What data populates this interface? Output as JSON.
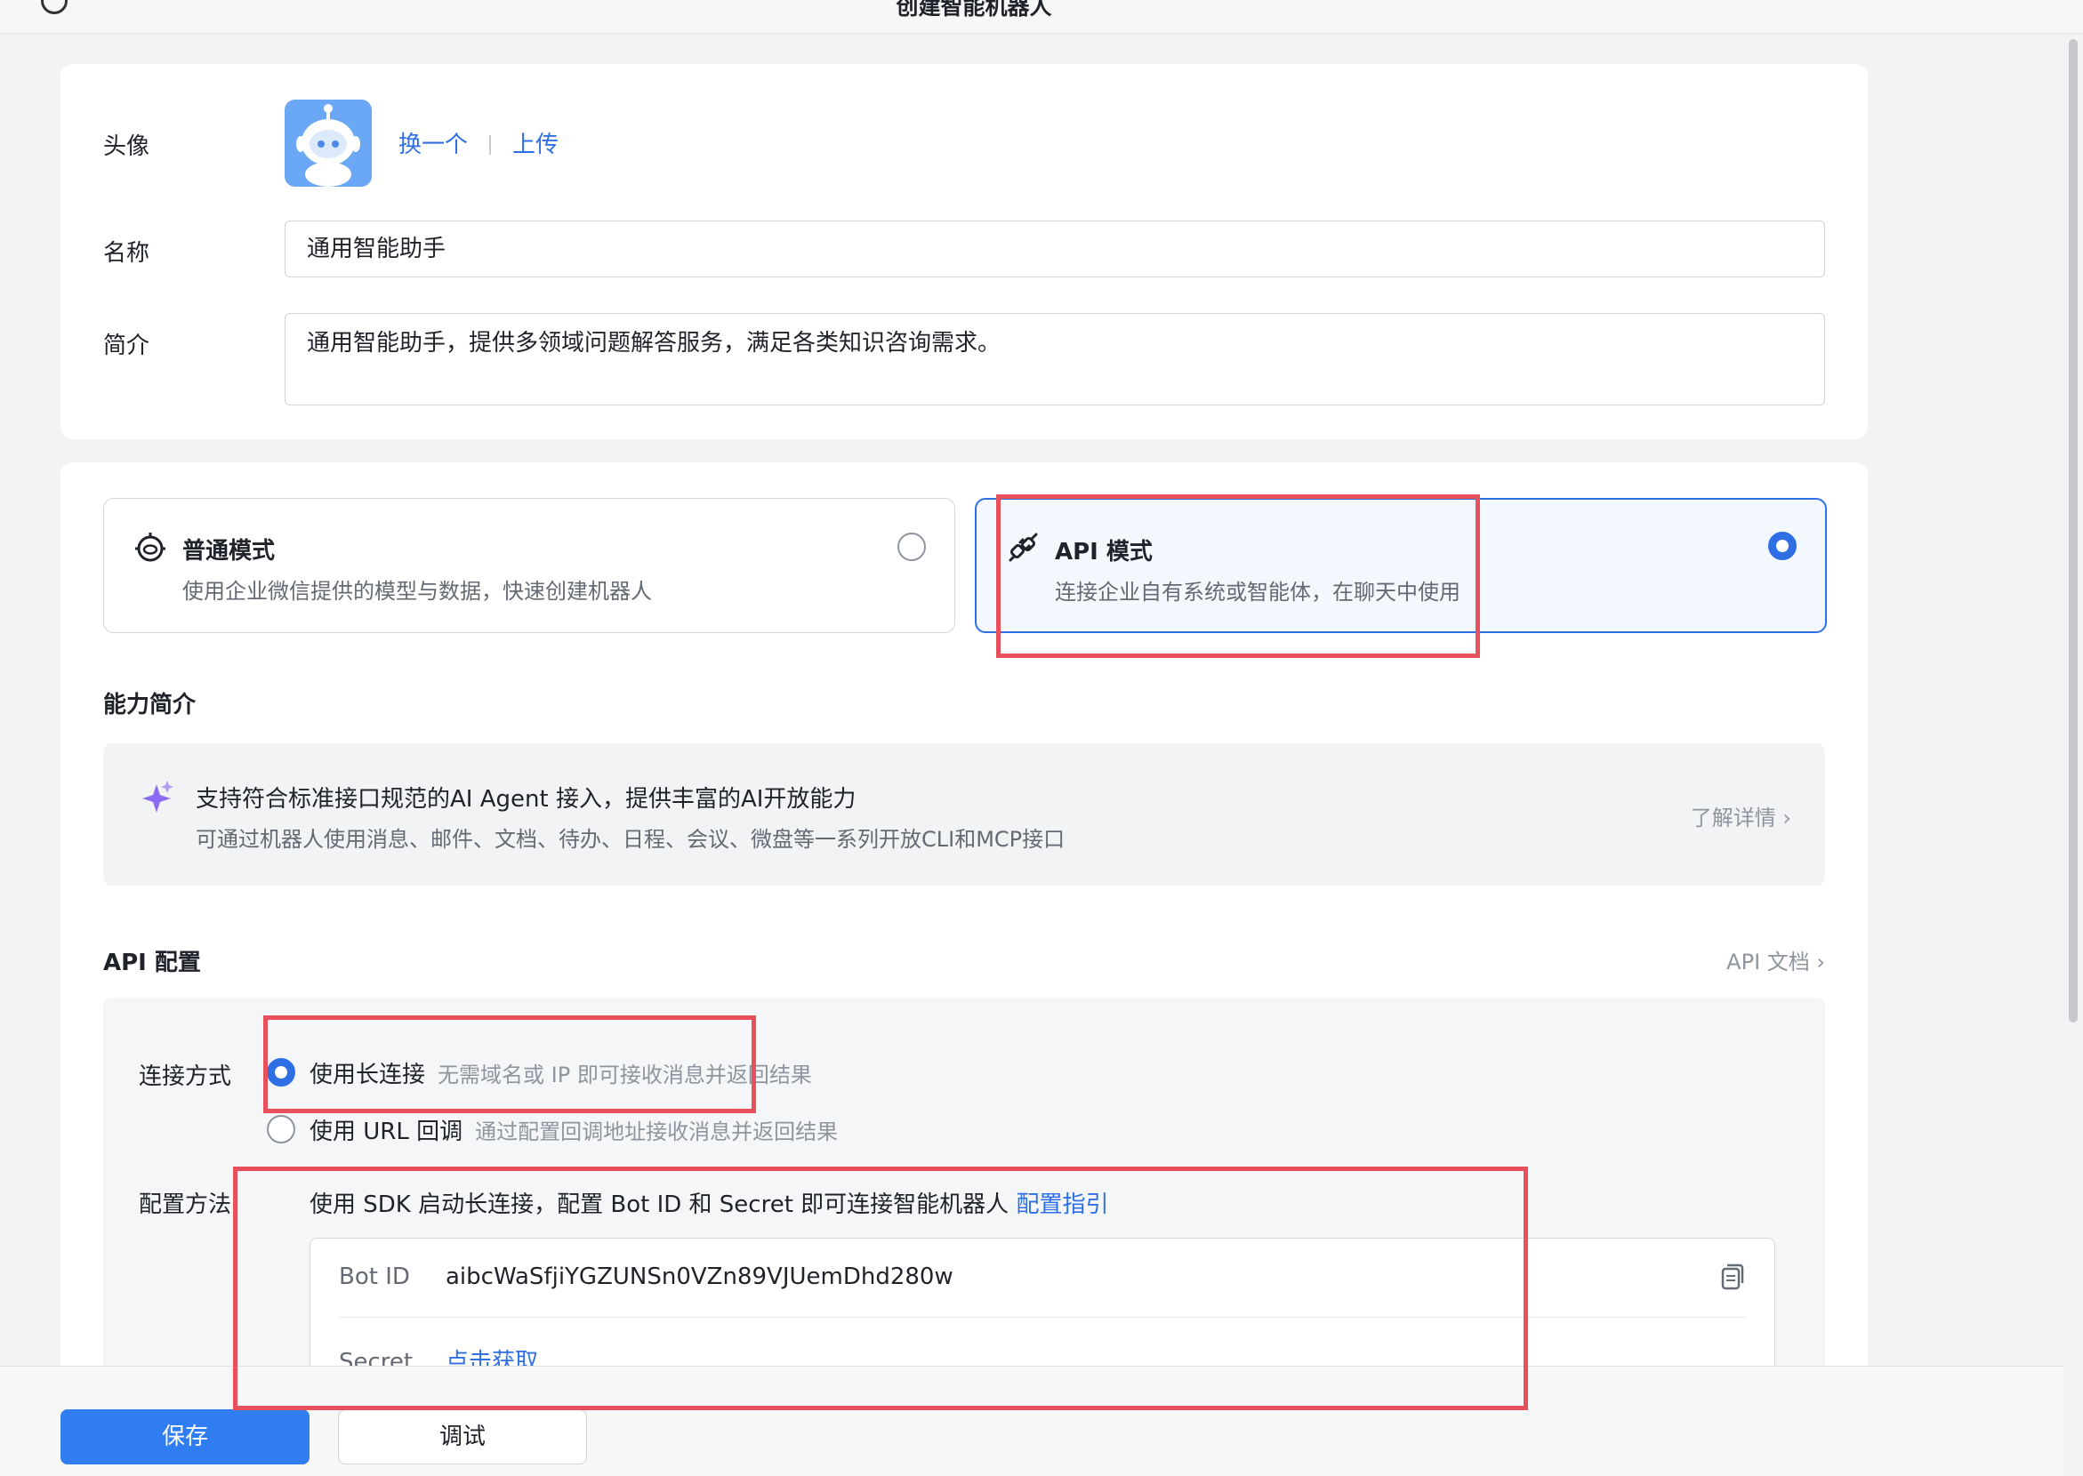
{
  "window": {
    "title": "创建智能机器人",
    "more_icon": "more-icon"
  },
  "basic": {
    "avatar_label": "头像",
    "avatar_change": "换一个",
    "avatar_upload": "上传",
    "name_label": "名称",
    "name_value": "通用智能助手",
    "desc_label": "简介",
    "desc_value": "通用智能助手，提供多领域问题解答服务，满足各类知识咨询需求。"
  },
  "modes": {
    "normal": {
      "title": "普通模式",
      "desc": "使用企业微信提供的模型与数据，快速创建机器人",
      "selected": false
    },
    "api": {
      "title": "API 模式",
      "desc": "连接企业自有系统或智能体，在聊天中使用",
      "selected": true
    }
  },
  "ability": {
    "section_title": "能力简介",
    "title": "支持符合标准接口规范的AI Agent 接入，提供丰富的AI开放能力",
    "desc": "可通过机器人使用消息、邮件、文档、待办、日程、会议、微盘等一系列开放CLI和MCP接口",
    "more": "了解详情 ›"
  },
  "api_config": {
    "section_title": "API 配置",
    "doc_link": "API 文档 ›",
    "conn_label": "连接方式",
    "options": [
      {
        "label": "使用长连接",
        "hint": "无需域名或 IP 即可接收消息并返回结果",
        "selected": true
      },
      {
        "label": "使用 URL 回调",
        "hint": "通过配置回调地址接收消息并返回结果",
        "selected": false
      }
    ],
    "method_label": "配置方法",
    "method_text": "使用 SDK 启动长连接，配置 Bot ID 和 Secret 即可连接智能机器人",
    "method_link": "配置指引",
    "bot_id_key": "Bot ID",
    "bot_id_value": "aibcWaSfjiYGZUNSn0VZn89VJUemDhd280w",
    "secret_key": "Secret",
    "secret_link": "点击获取"
  },
  "footer": {
    "save": "保存",
    "debug": "调试"
  },
  "colors": {
    "accent": "#2f6fe4",
    "highlight": "#e8515b",
    "primary_button": "#2f7df0"
  }
}
